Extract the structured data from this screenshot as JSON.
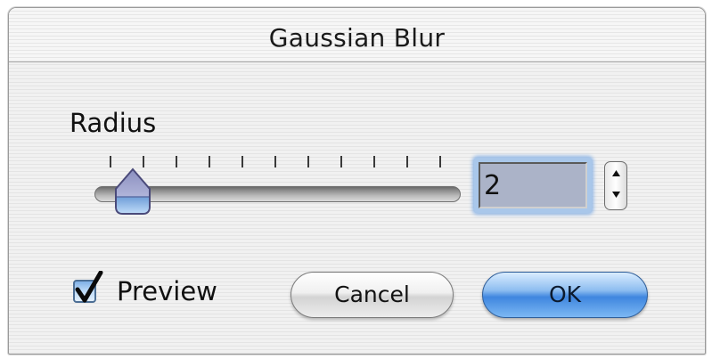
{
  "dialog": {
    "title": "Gaussian Blur",
    "radius_label": "Radius",
    "radius_value": "2",
    "slider": {
      "value": 2,
      "tick_count": 11
    },
    "preview": {
      "label": "Preview",
      "checked": true
    },
    "buttons": {
      "cancel": "Cancel",
      "ok": "OK"
    },
    "icons": {
      "slider_thumb": "slider-thumb-icon",
      "stepper_up": "arrow-up-icon",
      "stepper_down": "arrow-down-icon",
      "checkmark": "checkmark-icon"
    },
    "colors": {
      "ok_button": "#3f86df",
      "focus_ring": "#8fb6e6",
      "checkbox": "#7fb0e6"
    }
  }
}
